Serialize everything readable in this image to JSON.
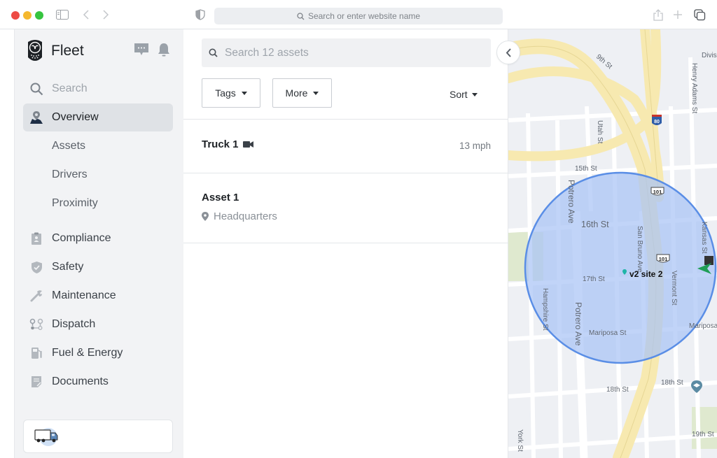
{
  "browser": {
    "url_placeholder": "Search or enter website name",
    "icons": [
      "sidebar-toggle-icon",
      "back-icon",
      "forward-icon",
      "privacy-shield-icon",
      "share-icon",
      "new-tab-icon",
      "tabs-overview-icon"
    ]
  },
  "sidebar": {
    "app_title": "Fleet",
    "search_label": "Search",
    "items": [
      {
        "label": "Overview",
        "icon": "map-pin-icon",
        "active": true
      },
      {
        "label": "Assets",
        "sub": true
      },
      {
        "label": "Drivers",
        "sub": true
      },
      {
        "label": "Proximity",
        "sub": true
      },
      {
        "label": "Compliance",
        "icon": "clipboard-icon"
      },
      {
        "label": "Safety",
        "icon": "shield-icon"
      },
      {
        "label": "Maintenance",
        "icon": "wrench-icon"
      },
      {
        "label": "Dispatch",
        "icon": "route-pins-icon"
      },
      {
        "label": "Fuel & Energy",
        "icon": "fuel-pump-icon"
      },
      {
        "label": "Documents",
        "icon": "document-icon"
      }
    ],
    "header_icons": [
      "chat-icon",
      "bell-icon"
    ]
  },
  "list": {
    "search_placeholder": "Search 12 assets",
    "filters": {
      "tags": "Tags",
      "more": "More",
      "sort": "Sort"
    },
    "rows": [
      {
        "name": "Truck 1",
        "icon": "video-camera-icon",
        "speed": "13 mph"
      },
      {
        "name": "Asset 1",
        "location": "Headquarters"
      }
    ]
  },
  "map": {
    "site_label": "v2 site 2",
    "streets": [
      "9th St",
      "Henry Adams St",
      "Division St",
      "Utah St",
      "15th St",
      "16th St",
      "17th St",
      "18th St",
      "19th St",
      "Potrero Ave",
      "San Bruno Ave",
      "Vermont St",
      "Kansas St",
      "Hampshire St",
      "Mariposa St",
      "York St"
    ],
    "highway_shields": [
      "80",
      "101",
      "101"
    ],
    "colors": {
      "geofence_fill": "#a9c4f5",
      "geofence_stroke": "#5a8ee6",
      "highway": "#f7e9b0",
      "park": "#dfe9cf",
      "site_pin": "#1fb5a8",
      "vehicle_arrow": "#1f9e57"
    }
  }
}
